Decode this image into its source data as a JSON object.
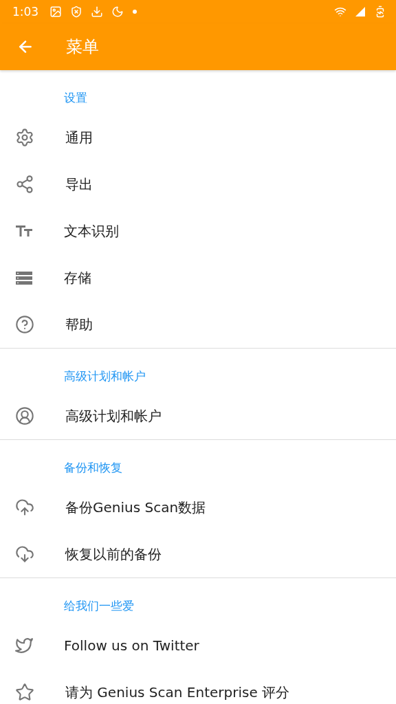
{
  "status_bar": {
    "time": "1:03"
  },
  "app_bar": {
    "title": "菜单"
  },
  "sections": [
    {
      "header": "设置",
      "items": [
        {
          "kind": "settings",
          "label": "通用"
        },
        {
          "kind": "share",
          "label": "导出"
        },
        {
          "kind": "text",
          "label": "文本识别"
        },
        {
          "kind": "storage",
          "label": "存储"
        },
        {
          "kind": "help",
          "label": "帮助"
        }
      ]
    },
    {
      "header": "高级计划和帐户",
      "items": [
        {
          "kind": "account",
          "label": "高级计划和帐户"
        }
      ]
    },
    {
      "header": "备份和恢复",
      "items": [
        {
          "kind": "upload",
          "label": "备份Genius Scan数据"
        },
        {
          "kind": "download",
          "label": "恢复以前的备份"
        }
      ]
    },
    {
      "header": "给我们一些爱",
      "items": [
        {
          "kind": "twitter",
          "label": "Follow us on Twitter"
        },
        {
          "kind": "star",
          "label": "请为 Genius Scan Enterprise 评分"
        }
      ]
    }
  ]
}
